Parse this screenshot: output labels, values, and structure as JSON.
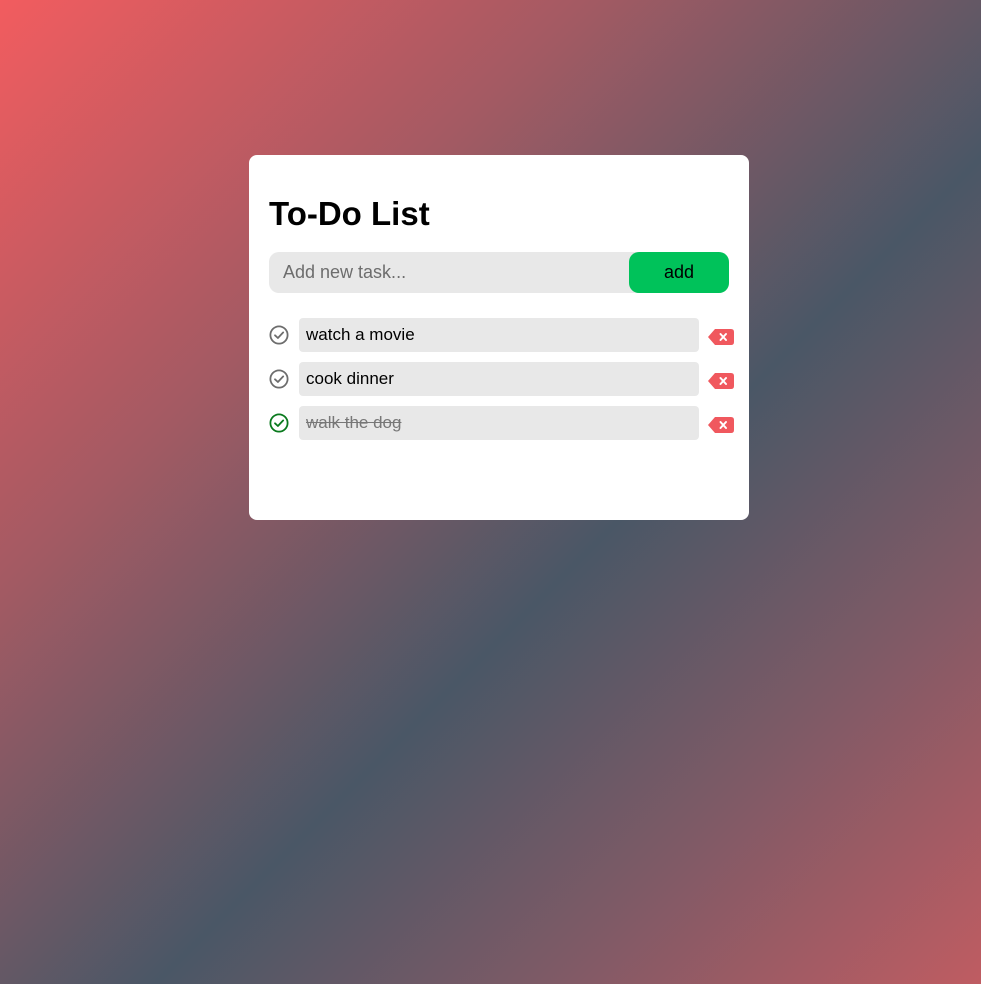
{
  "app": {
    "title": "To-Do List"
  },
  "new_task": {
    "placeholder": "Add new task...",
    "value": "",
    "add_label": "add"
  },
  "tasks": [
    {
      "text": "watch a movie",
      "completed": false,
      "check_icon": "check-circle-icon",
      "delete_icon": "backspace-delete-icon"
    },
    {
      "text": "cook dinner",
      "completed": false,
      "check_icon": "check-circle-icon",
      "delete_icon": "backspace-delete-icon"
    },
    {
      "text": "walk the dog",
      "completed": true,
      "check_icon": "check-circle-icon",
      "delete_icon": "backspace-delete-icon"
    }
  ],
  "colors": {
    "accent_add": "#00c25a",
    "delete": "#f0585e",
    "check_pending": "#6d6d6d",
    "check_done": "#0a7a1e",
    "completed_text": "#777777"
  }
}
